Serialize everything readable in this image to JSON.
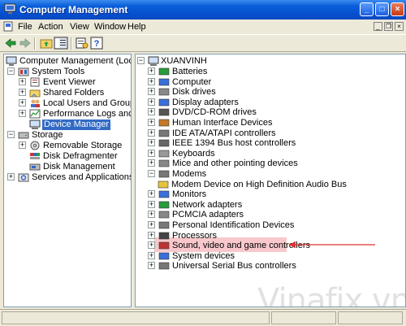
{
  "window": {
    "title": "Computer Management"
  },
  "menu": {
    "items": [
      "File",
      "Action",
      "View",
      "Window",
      "Help"
    ]
  },
  "left_tree": {
    "root": "Computer Management (Local)",
    "system_tools": "System Tools",
    "system_tools_children": [
      "Event Viewer",
      "Shared Folders",
      "Local Users and Groups",
      "Performance Logs and Alerts",
      "Device Manager"
    ],
    "storage": "Storage",
    "storage_children": [
      "Removable Storage",
      "Disk Defragmenter",
      "Disk Management"
    ],
    "services": "Services and Applications",
    "selected": "Device Manager"
  },
  "right_tree": {
    "root": "XUANVINH",
    "categories": [
      "Batteries",
      "Computer",
      "Disk drives",
      "Display adapters",
      "DVD/CD-ROM drives",
      "Human Interface Devices",
      "IDE ATA/ATAPI controllers",
      "IEEE 1394 Bus host controllers",
      "Keyboards",
      "Mice and other pointing devices",
      "Modems",
      "Modem Device on High Definition Audio Bus",
      "Monitors",
      "Network adapters",
      "PCMCIA adapters",
      "Personal Identification Devices",
      "Processors",
      "Sound, video and game controllers",
      "System devices",
      "Universal Serial Bus controllers"
    ],
    "highlighted": "Sound, video and game controllers"
  },
  "watermark": "Vinafix.vn",
  "colors": {
    "titlebar": "#0550d0",
    "selection": "#316ac5",
    "highlight": "#f8c8cc",
    "arrow": "#e03030"
  }
}
